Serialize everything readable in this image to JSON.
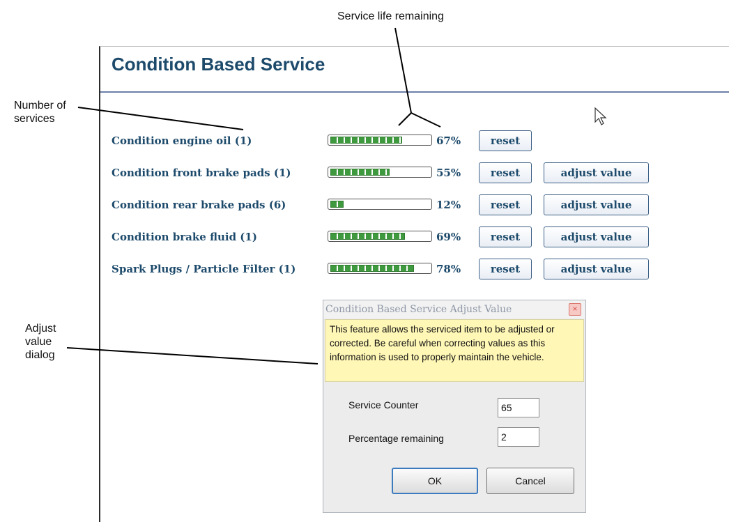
{
  "annotations": {
    "service_life": "Service life remaining",
    "number_of_services_line1": "Number of",
    "number_of_services_line2": "services",
    "adjust_dialog_line1": "Adjust",
    "adjust_dialog_line2": "value",
    "adjust_dialog_line3": "dialog"
  },
  "panel": {
    "title": "Condition Based Service"
  },
  "items": [
    {
      "label": "Condition engine oil (1)",
      "percent_text": "67%",
      "fill": 0.67,
      "has_adjust": false
    },
    {
      "label": "Condition front brake pads (1)",
      "percent_text": "55%",
      "fill": 0.55,
      "has_adjust": true
    },
    {
      "label": "Condition rear brake pads (6)",
      "percent_text": "12%",
      "fill": 0.12,
      "has_adjust": true
    },
    {
      "label": "Condition brake fluid (1)",
      "percent_text": "69%",
      "fill": 0.69,
      "has_adjust": true
    },
    {
      "label": "Spark Plugs / Particle Filter (1)",
      "percent_text": "78%",
      "fill": 0.78,
      "has_adjust": true
    }
  ],
  "buttons": {
    "reset": "reset",
    "adjust": "adjust value"
  },
  "dialog": {
    "title": "Condition Based Service Adjust Value",
    "close_glyph": "×",
    "note": "This feature allows the serviced item to be adjusted or corrected. Be careful when correcting values as this information is used to properly maintain the vehicle.",
    "fields": [
      {
        "label": "Service Counter",
        "value": "65"
      },
      {
        "label": "Percentage remaining",
        "value": "2"
      }
    ],
    "ok": "OK",
    "cancel": "Cancel"
  },
  "icons": {
    "cursor": "mouse-pointer-icon",
    "close": "close-icon"
  },
  "colors": {
    "title": "#1d4a6b",
    "bar_fill": "#3f9a3f",
    "note_bg": "#fff7b6"
  }
}
